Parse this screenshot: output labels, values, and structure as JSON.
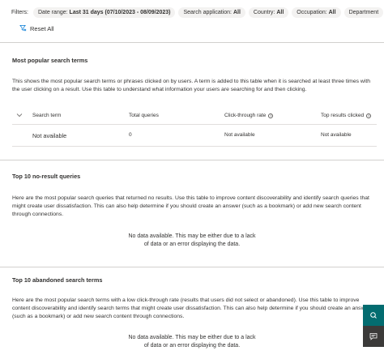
{
  "filters": {
    "label": "Filters:",
    "pills": [
      {
        "name": "Date range:",
        "value": "Last 31 days (07/10/2023 - 08/09/2023)"
      },
      {
        "name": "Search application:",
        "value": "All"
      },
      {
        "name": "Country:",
        "value": "All"
      },
      {
        "name": "Occupation:",
        "value": "All"
      },
      {
        "name": "Department",
        "value": ""
      }
    ],
    "reset_label": "Reset All"
  },
  "popular": {
    "title": "Most popular search terms",
    "description": "This shows the most popular search terms or phrases clicked on by users. A term is added to this table when it is searched at least three times with the user clicking on a result. Use this table to understand what information your users are searching for and then clicking.",
    "columns": [
      "Search term",
      "Total queries",
      "Click-through rate",
      "Top results clicked"
    ],
    "row": {
      "term": "Not available",
      "total": "0",
      "ctr": "Not available",
      "top": "Not available"
    }
  },
  "noresult": {
    "title": "Top 10 no-result queries",
    "description": "Here are the most popular search queries that returned no results. Use this table to improve content discoverability and identify search queries that might create user dissatisfaction. This can also help determine if you should create an answer (such as a bookmark) or add new search content through connections.",
    "nodata_line1": "No data available. This may be either due to a lack",
    "nodata_line2": "of data or an error displaying the data."
  },
  "abandoned": {
    "title": "Top 10 abandoned search terms",
    "description": "Here are the most popular search terms with a low click-through rate (results that users did not select or abandoned). Use this table to improve content discoverability and identify search terms that might create user dissatisfaction. This can also help determine if you should create an answer (such as a bookmark) or add new search content through connections.",
    "nodata_line1": "No data available. This may be either due to a lack",
    "nodata_line2": "of data or an error displaying the data."
  },
  "colors": {
    "accent_teal": "#036c70",
    "accent_dark": "#3b3a39",
    "pill_bg": "#f3f2f1"
  },
  "icons": [
    "funnel-clear-icon",
    "chevron-down-icon",
    "info-icon",
    "feedback-icon",
    "chat-icon"
  ]
}
